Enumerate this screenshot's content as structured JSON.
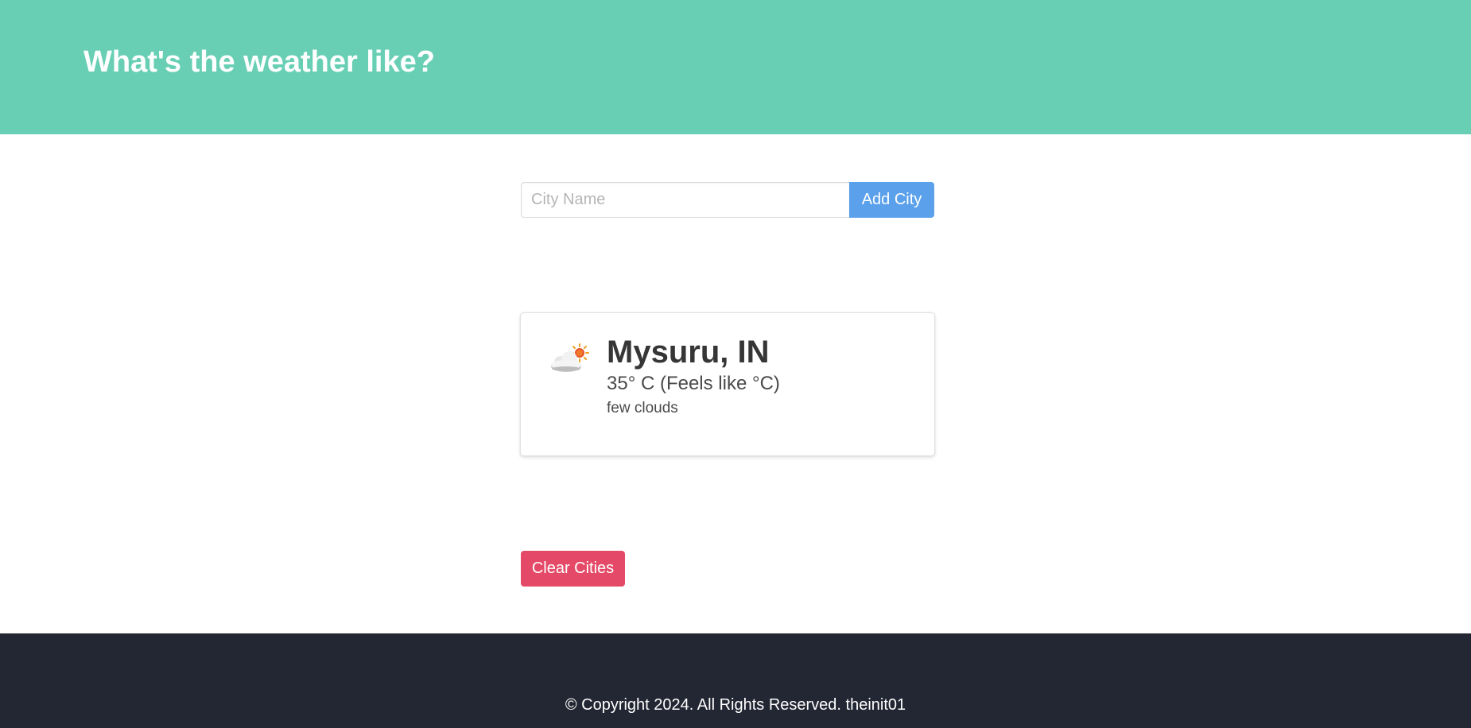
{
  "header": {
    "title": "What's the weather like?",
    "background_color": "#68cfb4"
  },
  "search": {
    "placeholder": "City Name",
    "value": "",
    "add_button_label": "Add City",
    "add_button_color": "#5aa0ea"
  },
  "cities": [
    {
      "name": "Mysuru, IN",
      "temperature": "35° C (Feels like °C)",
      "description": "few clouds",
      "icon": "few-clouds-icon"
    }
  ],
  "actions": {
    "clear_label": "Clear Cities",
    "clear_color": "#e44a67"
  },
  "footer": {
    "text": "© Copyright 2024. All Rights Reserved. theinit01",
    "background_color": "#232633"
  }
}
